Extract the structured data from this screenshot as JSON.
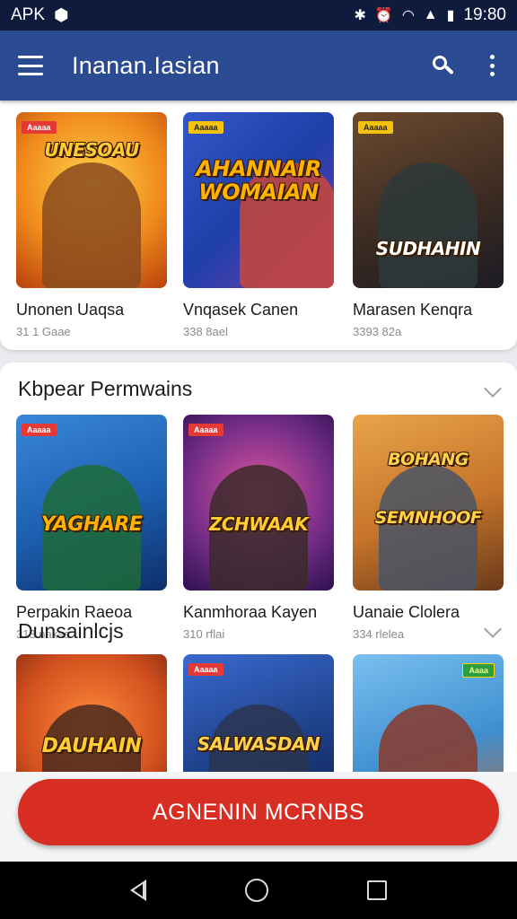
{
  "status_bar": {
    "left_text": "APK",
    "time": "19:80"
  },
  "app_bar": {
    "title": "Inanan.Iasian",
    "icons": [
      "menu-icon",
      "search-icon",
      "more-vert-icon"
    ]
  },
  "featured": {
    "items": [
      {
        "name": "Unonen Uaqsa",
        "meta": "31 1 Gaae",
        "art_title": "UNESOAU",
        "badge": "Aaaaa",
        "badge_color": "red",
        "bg": "#f08a1c"
      },
      {
        "name": "Vnqasek Canen",
        "meta": "338 8ael",
        "art_title": "AHANNAIR WOMAIAN",
        "badge": "Aaaaa",
        "badge_color": "yellow",
        "bg": "#1e3fa8"
      },
      {
        "name": "Marasen Kenqra",
        "meta": "3393 82a",
        "art_title": "SUDHAHIN",
        "badge": "Aaaaa",
        "badge_color": "yellow",
        "bg": "#3a2a22"
      }
    ]
  },
  "sections": [
    {
      "title": "Kbpear Permwains",
      "items": [
        {
          "name": "Perpakin Raeoa",
          "meta": "313 nakas",
          "art_title": "YAGHARE",
          "badge": "Aaaaa",
          "badge_color": "red",
          "bg": "#1c5fb0"
        },
        {
          "name": "Kanmhoraa Kayen",
          "meta": "310 rflai",
          "art_title": "ZCHWAAK",
          "badge": "Aaaaa",
          "badge_color": "red",
          "bg": "#7a2f8a"
        },
        {
          "name": "Uanaie Clolera",
          "meta": "334 rlelea",
          "art_title": "BOHANG SEMNHOOF",
          "badge": "",
          "badge_color": "",
          "bg": "#c5742a"
        }
      ]
    },
    {
      "title": "Dunsainlcjs",
      "items": [
        {
          "name": "",
          "meta": "",
          "art_title": "DAUHAIN",
          "badge": "",
          "badge_color": "",
          "bg": "#d2501e"
        },
        {
          "name": "",
          "meta": "",
          "art_title": "SALWASDAN",
          "badge": "Aaaaa",
          "badge_color": "red",
          "bg": "#1d3f86"
        },
        {
          "name": "",
          "meta": "",
          "art_title": "",
          "badge": "Aaaa",
          "badge_color": "green",
          "bg": "#3f8fd0"
        }
      ]
    }
  ],
  "cta": {
    "label": "AGNENIN MCRNBS"
  },
  "nav": {
    "icons": [
      "back-icon",
      "home-icon",
      "recents-icon"
    ]
  }
}
